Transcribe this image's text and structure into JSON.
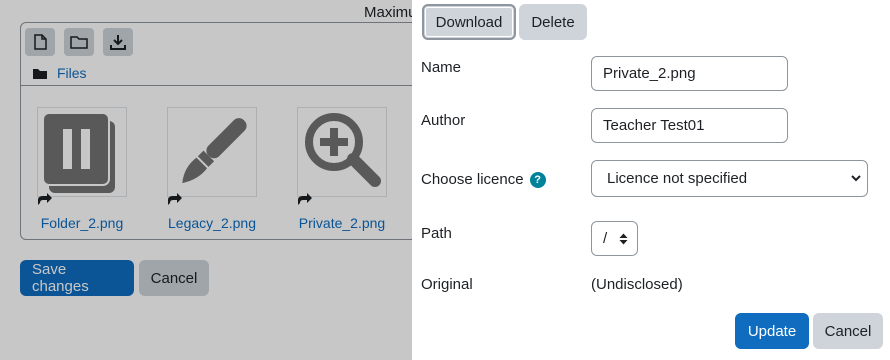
{
  "background": {
    "max_label": "Maximu",
    "path_label": "Files",
    "files": [
      {
        "name": "Folder_2.png",
        "icon": "pause-file-icon"
      },
      {
        "name": "Legacy_2.png",
        "icon": "paintbrush-icon"
      },
      {
        "name": "Private_2.png",
        "icon": "zoom-in-icon"
      }
    ],
    "save_label": "Save changes",
    "cancel_label": "Cancel"
  },
  "dialog": {
    "download_label": "Download",
    "delete_label": "Delete",
    "name_label": "Name",
    "name_value": "Private_2.png",
    "author_label": "Author",
    "author_value": "Teacher Test01",
    "licence_label": "Choose licence",
    "licence_value": "Licence not specified",
    "path_label": "Path",
    "path_value": "/",
    "original_label": "Original",
    "original_value": "(Undisclosed)",
    "update_label": "Update",
    "cancel_label": "Cancel"
  },
  "colors": {
    "primary": "#0f6cbf",
    "secondary": "#ced4da",
    "help": "#00829b"
  }
}
